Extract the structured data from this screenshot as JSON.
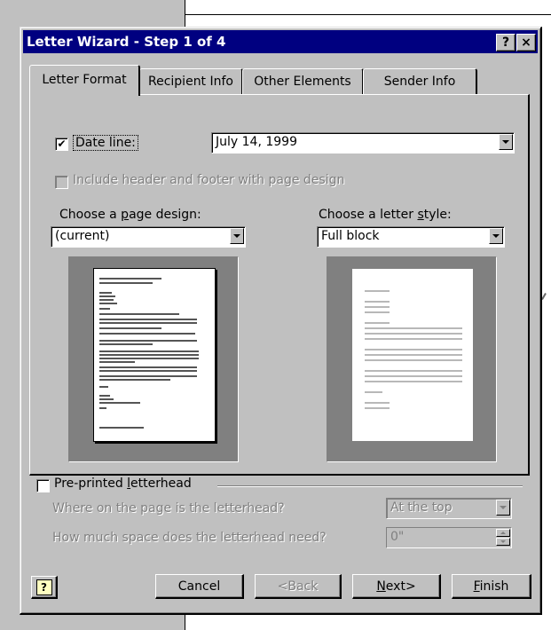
{
  "window": {
    "title": "Letter Wizard - Step 1 of 4",
    "help_button": "?",
    "close_button": "×"
  },
  "tabs": [
    {
      "label": "Letter Format",
      "active": true
    },
    {
      "label": "Recipient Info",
      "active": false
    },
    {
      "label": "Other Elements",
      "active": false
    },
    {
      "label": "Sender Info",
      "active": false
    }
  ],
  "date_line": {
    "checked": true,
    "check_mark": "✔",
    "label": "Date line:",
    "value": "July 14, 1999"
  },
  "header_footer": {
    "checked": false,
    "label": "Include header and footer with page design",
    "enabled": false
  },
  "page_design": {
    "label_pre": "Choose a ",
    "label_key": "p",
    "label_post": "age design:",
    "value": "(current)"
  },
  "letter_style": {
    "label_pre": "Choose a letter ",
    "label_key": "s",
    "label_post": "tyle:",
    "value": "Full block"
  },
  "letterhead": {
    "checked": false,
    "label_pre": "Pre-printed ",
    "label_key": "l",
    "label_post": "etterhead",
    "where_label": "Where on the page is the letterhead?",
    "where_value": "At the top",
    "space_label": "How much space does the letterhead need?",
    "space_value": "0\""
  },
  "buttons": {
    "help_icon": "?",
    "cancel": "Cancel",
    "back": "<Back",
    "next_key": "N",
    "next_rest": "ext>",
    "finish_key": "F",
    "finish_rest": "inish"
  },
  "colors": {
    "titlebar": "#000080",
    "face": "#c0c0c0",
    "disabled_text": "#808080"
  }
}
